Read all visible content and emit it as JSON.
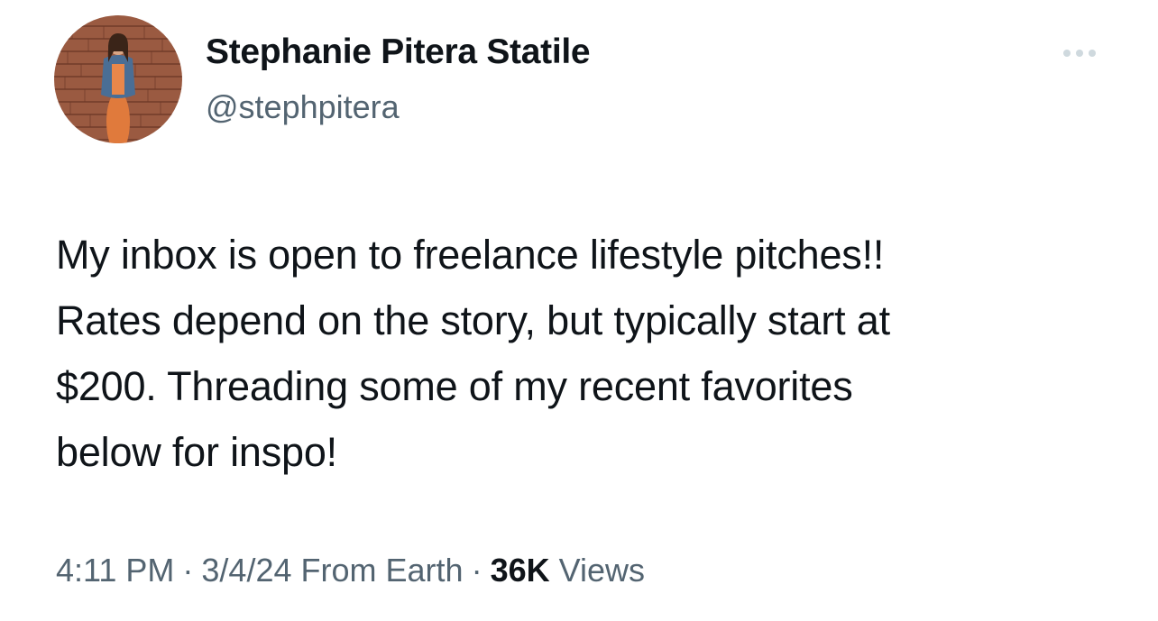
{
  "tweet": {
    "author": {
      "display_name": "Stephanie Pitera Statile",
      "handle": "@stephpitera",
      "avatar_icon": "user-avatar-photo"
    },
    "more_icon": "ellipsis-horizontal-icon",
    "text": "My inbox is open to freelance lifestyle pitches!!\nRates depend on the story, but typically start at\n$200. Threading some of my recent favorites\nbelow for inspo!",
    "meta": {
      "time": "4:11 PM",
      "date": "3/4/24",
      "location": "From Earth",
      "separator": "·",
      "views_count": "36K",
      "views_label": "Views"
    }
  },
  "colors": {
    "text_primary": "#0f1419",
    "text_secondary": "#536471",
    "more_icon": "#cfd9de",
    "background": "#ffffff"
  }
}
